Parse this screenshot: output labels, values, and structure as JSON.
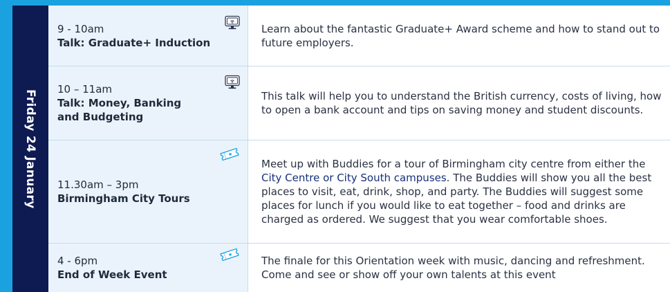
{
  "day_label": "Friday 24 January",
  "sessions": [
    {
      "time": "9 - 10am",
      "title": "Talk: Graduate+ Induction",
      "icon": "online-screen-icon",
      "description": "Learn about the fantastic Graduate+ Award scheme and how to stand out to future employers."
    },
    {
      "time": "10 – 11am",
      "title": "Talk: Money, Banking and Budgeting",
      "icon": "online-screen-icon",
      "description": "This talk will help you to understand the British currency, costs of living, how to open a bank account and tips on saving money and student discounts."
    },
    {
      "time": "11.30am – 3pm",
      "title": "Birmingham City Tours",
      "icon": "ticket-icon",
      "description_before": "Meet up with Buddies for a tour of Birmingham city centre from either the ",
      "description_highlight": "City Centre or City South campuses",
      "description_after": ". The Buddies will show you all the best places to visit, eat, drink, shop, and party. The Buddies will suggest some places for lunch if you would like to eat together – food and drinks are charged as ordered. We suggest that you wear comfortable shoes."
    },
    {
      "time": "4 - 6pm",
      "title": "End of Week Event",
      "icon": "ticket-icon",
      "description": "The finale for this Orientation week with music, dancing and refreshment. Come and see or show off your own talents at this event"
    }
  ],
  "colors": {
    "accent_blue": "#1aa2e0",
    "navy": "#0e1a52",
    "time_cell_bg": "#eaf3fb"
  }
}
